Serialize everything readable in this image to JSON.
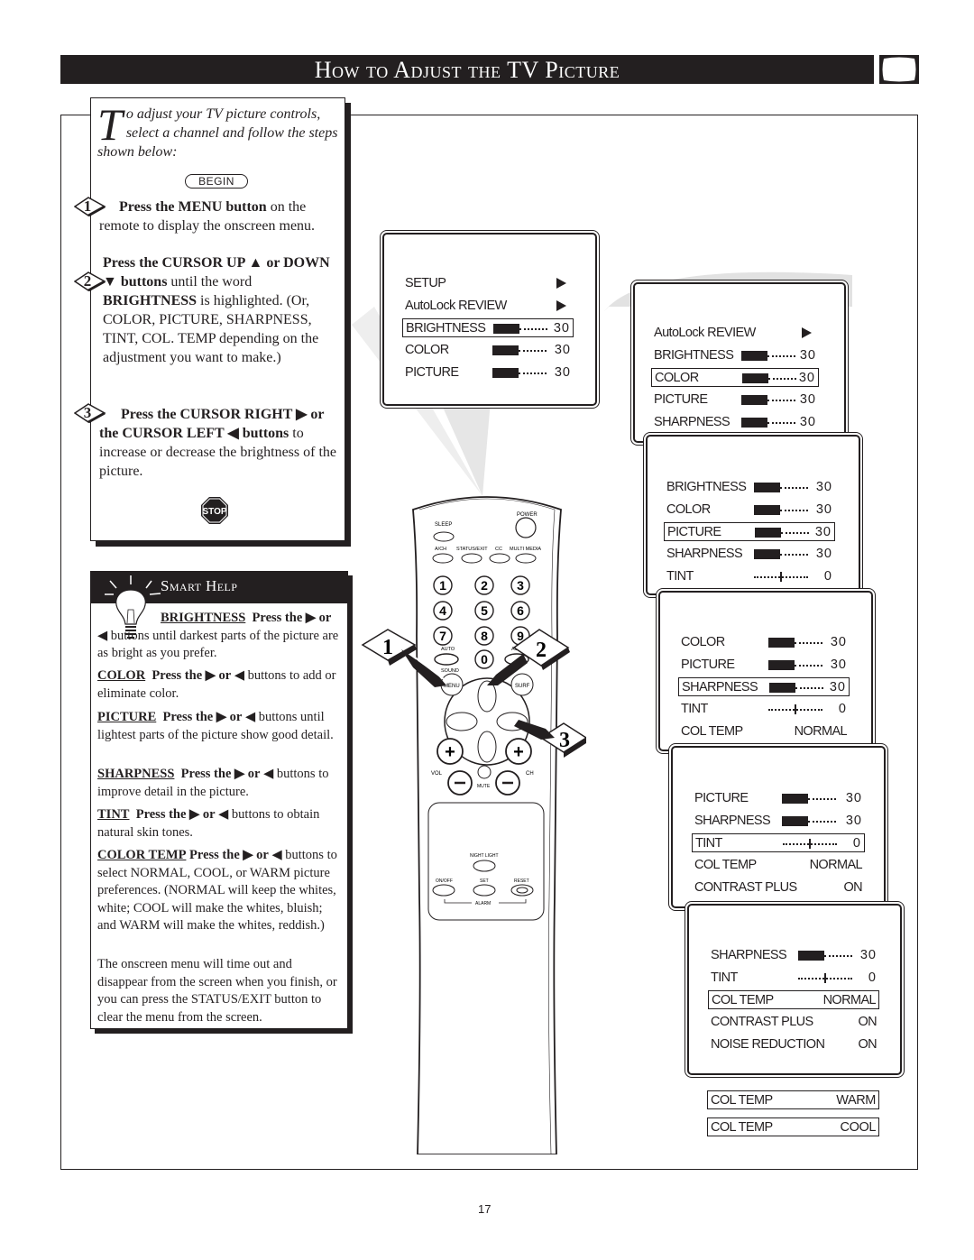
{
  "header": {
    "title": "How to Adjust the TV Picture",
    "section_icon": "tv-screen-icon"
  },
  "instructions": {
    "intro_dropcap": "T",
    "intro_rest": "o adjust your TV picture controls, select a channel and follow the steps shown below:",
    "begin_label": "BEGIN",
    "steps": [
      {
        "number": "1",
        "bold": "Press the MENU button",
        "text": " on the remote to display the onscreen menu."
      },
      {
        "number": "2",
        "bold_a": "Press the CURSOR UP ▲ or DOWN ▼ buttons",
        "text_a": " until the word ",
        "bold_b": "BRIGHTNESS",
        "text_b": " is highlighted. (Or, COLOR, PICTURE, SHARPNESS, TINT, COL. TEMP depending on the adjustment you want to make.)"
      },
      {
        "number": "3",
        "bold": "Press the CURSOR RIGHT ▶ or the CURSOR LEFT ◀ buttons",
        "text": " to increase or decrease the brightness of the picture."
      }
    ],
    "stop_icon": "STOP"
  },
  "smart_help": {
    "title": "Smart Help",
    "items": [
      {
        "term": "BRIGHTNESS",
        "bold": "Press the ▶ or",
        "text": " ◀ buttons until darkest parts of the picture are as bright as you prefer."
      },
      {
        "term": "COLOR",
        "bold": "Press the ▶ or",
        "text": " ◀ buttons to add or eliminate color."
      },
      {
        "term": "PICTURE",
        "bold": "Press the ▶ or",
        "text": " ◀ buttons until lightest parts of the picture show good detail."
      },
      {
        "term": "SHARPNESS",
        "bold": "Press the ▶ or",
        "text": " ◀ buttons to improve detail in the picture."
      },
      {
        "term": "TINT",
        "bold": "Press the ▶ or",
        "text": " ◀ buttons to obtain natural skin tones."
      },
      {
        "term": "COLOR TEMP",
        "bold": "Press the ▶ or",
        "text": " ◀ buttons to select NORMAL, COOL, or WARM picture preferences. (NORMAL will keep the whites, white; COOL will make the whites, bluish; and WARM will make the whites, reddish.)"
      }
    ],
    "footer": "The onscreen menu will time out and disappear from the screen when you finish, or you can press the STATUS/EXIT button to clear the menu from the screen."
  },
  "screens": [
    {
      "rows": [
        {
          "label": "SETUP",
          "type": "arrow"
        },
        {
          "label": "AutoLock REVIEW",
          "type": "arrow"
        },
        {
          "label": "BRIGHTNESS",
          "type": "bar",
          "value": "30",
          "fill": 0.5,
          "highlight": true
        },
        {
          "label": "COLOR",
          "type": "bar",
          "value": "30",
          "fill": 0.5
        },
        {
          "label": "PICTURE",
          "type": "bar",
          "value": "30",
          "fill": 0.5
        }
      ]
    },
    {
      "rows": [
        {
          "label": "AutoLock REVIEW",
          "type": "arrow"
        },
        {
          "label": "BRIGHTNESS",
          "type": "bar",
          "value": "30",
          "fill": 0.5
        },
        {
          "label": "COLOR",
          "type": "bar",
          "value": "30",
          "fill": 0.5,
          "highlight": true
        },
        {
          "label": "PICTURE",
          "type": "bar",
          "value": "30",
          "fill": 0.5
        },
        {
          "label": "SHARPNESS",
          "type": "bar",
          "value": "30",
          "fill": 0.5
        }
      ]
    },
    {
      "rows": [
        {
          "label": "BRIGHTNESS",
          "type": "bar",
          "value": "30",
          "fill": 0.5
        },
        {
          "label": "COLOR",
          "type": "bar",
          "value": "30",
          "fill": 0.5
        },
        {
          "label": "PICTURE",
          "type": "bar",
          "value": "30",
          "fill": 0.5,
          "highlight": true
        },
        {
          "label": "SHARPNESS",
          "type": "bar",
          "value": "30",
          "fill": 0.5
        },
        {
          "label": "TINT",
          "type": "center",
          "value": "0",
          "fill": 0.5
        }
      ]
    },
    {
      "rows": [
        {
          "label": "COLOR",
          "type": "bar",
          "value": "30",
          "fill": 0.5
        },
        {
          "label": "PICTURE",
          "type": "bar",
          "value": "30",
          "fill": 0.5
        },
        {
          "label": "SHARPNESS",
          "type": "bar",
          "value": "30",
          "fill": 0.5,
          "highlight": true
        },
        {
          "label": "TINT",
          "type": "center",
          "value": "0",
          "fill": 0.5
        },
        {
          "label": "COL TEMP",
          "type": "text",
          "value": "NORMAL"
        }
      ]
    },
    {
      "rows": [
        {
          "label": "PICTURE",
          "type": "bar",
          "value": "30",
          "fill": 0.5
        },
        {
          "label": "SHARPNESS",
          "type": "bar",
          "value": "30",
          "fill": 0.5
        },
        {
          "label": "TINT",
          "type": "center",
          "value": "0",
          "fill": 0.5,
          "highlight": true
        },
        {
          "label": "COL TEMP",
          "type": "text",
          "value": "NORMAL"
        },
        {
          "label": "CONTRAST PLUS",
          "type": "text",
          "value": "ON"
        }
      ]
    },
    {
      "rows": [
        {
          "label": "SHARPNESS",
          "type": "bar",
          "value": "30",
          "fill": 0.5
        },
        {
          "label": "TINT",
          "type": "center",
          "value": "0",
          "fill": 0.5
        },
        {
          "label": "COL TEMP",
          "type": "text",
          "value": "NORMAL",
          "highlight": true
        },
        {
          "label": "CONTRAST PLUS",
          "type": "text",
          "value": "ON"
        },
        {
          "label": "NOISE REDUCTION",
          "type": "text",
          "value": "ON"
        }
      ]
    }
  ],
  "col_temp_options": [
    {
      "label": "COL TEMP",
      "value": "WARM"
    },
    {
      "label": "COL TEMP",
      "value": "COOL"
    }
  ],
  "remote": {
    "power": "POWER",
    "sleep": "SLEEP",
    "top_row": [
      "A/CH",
      "STATUS/EXIT",
      "CC",
      "MULTI MEDIA"
    ],
    "digits": [
      "1",
      "2",
      "3",
      "4",
      "5",
      "6",
      "7",
      "8",
      "9",
      "0"
    ],
    "auto_left": "AUTO",
    "auto_right": "AUTO",
    "sound": "SOUND",
    "menu": "MENU",
    "surf": "SURF",
    "vol": "VOL",
    "ch": "CH",
    "mute": "MUTE",
    "night_light": "NIGHT LIGHT",
    "on_off": "ON/OFF",
    "set": "SET",
    "reset": "RESET",
    "alarm": "ALARM",
    "callouts": [
      "1",
      "2",
      "3"
    ]
  },
  "page_number": "17"
}
